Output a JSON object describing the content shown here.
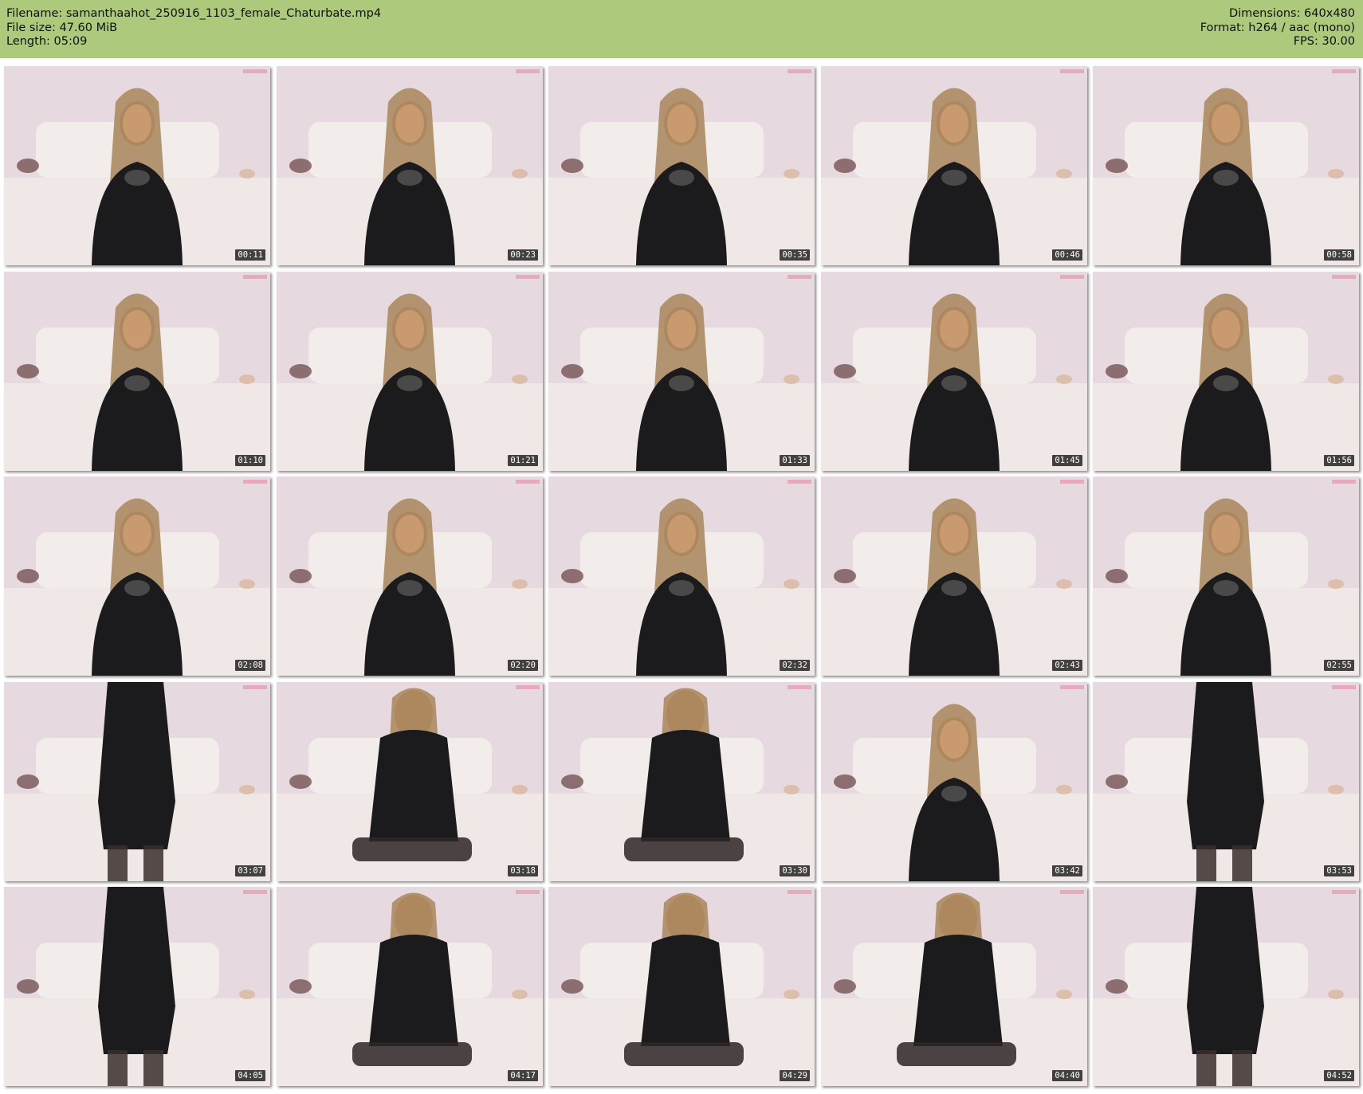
{
  "header": {
    "filename_line": "Filename: samanthaahot_250916_1103_female_Chaturbate.mp4",
    "filesize_line": "File size: 47.60 MiB",
    "length_line": "Length: 05:09",
    "dimensions_line": "Dimensions: 640x480",
    "format_line": "Format: h264 / aac (mono)",
    "fps_line": "FPS: 30.00"
  },
  "colors": {
    "header_bg": "#acc97c",
    "timestamp_bg": "#000000",
    "timestamp_text": "#ffffff"
  },
  "grid": {
    "columns": 5,
    "rows": 5
  },
  "thumbnails": [
    {
      "timestamp": "00:11",
      "pose": "seated"
    },
    {
      "timestamp": "00:23",
      "pose": "seated"
    },
    {
      "timestamp": "00:35",
      "pose": "seated"
    },
    {
      "timestamp": "00:46",
      "pose": "seated"
    },
    {
      "timestamp": "00:58",
      "pose": "seated"
    },
    {
      "timestamp": "01:10",
      "pose": "seated"
    },
    {
      "timestamp": "01:21",
      "pose": "seated"
    },
    {
      "timestamp": "01:33",
      "pose": "seated"
    },
    {
      "timestamp": "01:45",
      "pose": "seated"
    },
    {
      "timestamp": "01:56",
      "pose": "seated"
    },
    {
      "timestamp": "02:08",
      "pose": "seated"
    },
    {
      "timestamp": "02:20",
      "pose": "seated"
    },
    {
      "timestamp": "02:32",
      "pose": "seated"
    },
    {
      "timestamp": "02:43",
      "pose": "seated"
    },
    {
      "timestamp": "02:55",
      "pose": "seated"
    },
    {
      "timestamp": "03:07",
      "pose": "standing"
    },
    {
      "timestamp": "03:18",
      "pose": "kneeling"
    },
    {
      "timestamp": "03:30",
      "pose": "kneeling"
    },
    {
      "timestamp": "03:42",
      "pose": "seated"
    },
    {
      "timestamp": "03:53",
      "pose": "standing"
    },
    {
      "timestamp": "04:05",
      "pose": "standing"
    },
    {
      "timestamp": "04:17",
      "pose": "kneeling"
    },
    {
      "timestamp": "04:29",
      "pose": "kneeling"
    },
    {
      "timestamp": "04:40",
      "pose": "kneeling"
    },
    {
      "timestamp": "04:52",
      "pose": "standing"
    }
  ]
}
